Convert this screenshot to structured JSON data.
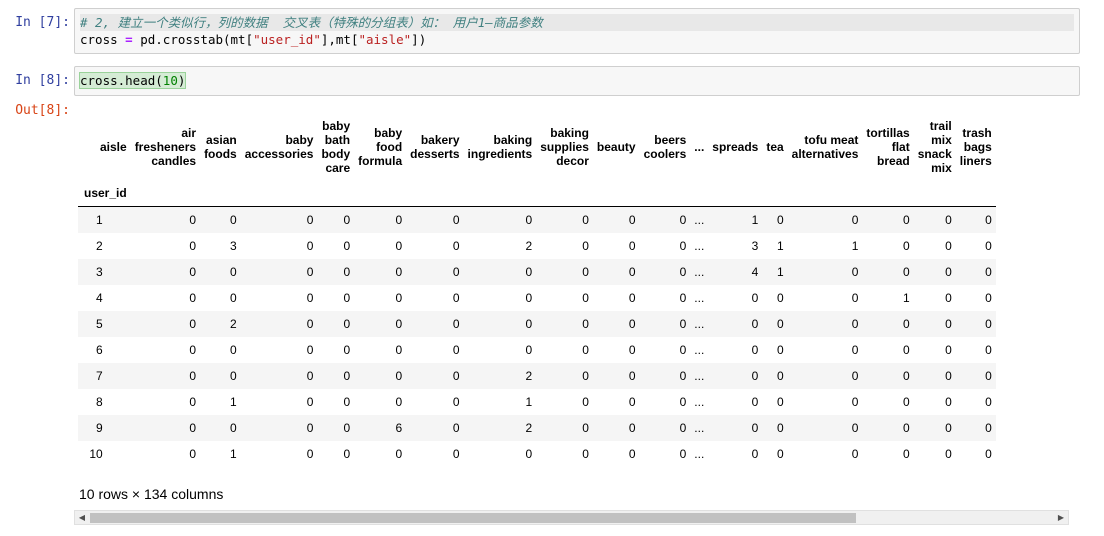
{
  "cells": [
    {
      "prompt": "In  [7]:",
      "comment": "# 2, 建立一个类似行，列的数据  交叉表（特殊的分组表）如： 用户1—商品参数",
      "code_pre": "cross ",
      "code_eq": "=",
      "code_mid": " pd.crosstab(mt[",
      "str1": "\"user_id\"",
      "code_mid2": "],mt[",
      "str2": "\"aisle\"",
      "code_end": "])"
    },
    {
      "prompt": "In  [8]:",
      "code_pre": "cross.head(",
      "num": "10",
      "code_end": ")"
    }
  ],
  "output": {
    "prompt": "Out[8]:",
    "column_label": "aisle",
    "index_label": "user_id",
    "columns": [
      [
        "air",
        "fresheners",
        "candles"
      ],
      [
        "asian",
        "foods"
      ],
      [
        "baby",
        "accessories"
      ],
      [
        "baby",
        "bath",
        "body",
        "care"
      ],
      [
        "baby",
        "food",
        "formula"
      ],
      [
        "bakery",
        "desserts"
      ],
      [
        "baking",
        "ingredients"
      ],
      [
        "baking",
        "supplies",
        "decor"
      ],
      [
        "beauty"
      ],
      [
        "beers",
        "coolers"
      ],
      [
        "..."
      ],
      [
        "spreads"
      ],
      [
        "tea"
      ],
      [
        "tofu meat",
        "alternatives"
      ],
      [
        "tortillas",
        "flat",
        "bread"
      ],
      [
        "trail",
        "mix",
        "snack",
        "mix"
      ],
      [
        "trash",
        "bags",
        "liners"
      ]
    ],
    "rows": [
      {
        "index": "1",
        "values": [
          "0",
          "0",
          "0",
          "0",
          "0",
          "0",
          "0",
          "0",
          "0",
          "0",
          "...",
          "1",
          "0",
          "0",
          "0",
          "0",
          "0"
        ]
      },
      {
        "index": "2",
        "values": [
          "0",
          "3",
          "0",
          "0",
          "0",
          "0",
          "2",
          "0",
          "0",
          "0",
          "...",
          "3",
          "1",
          "1",
          "0",
          "0",
          "0"
        ]
      },
      {
        "index": "3",
        "values": [
          "0",
          "0",
          "0",
          "0",
          "0",
          "0",
          "0",
          "0",
          "0",
          "0",
          "...",
          "4",
          "1",
          "0",
          "0",
          "0",
          "0"
        ]
      },
      {
        "index": "4",
        "values": [
          "0",
          "0",
          "0",
          "0",
          "0",
          "0",
          "0",
          "0",
          "0",
          "0",
          "...",
          "0",
          "0",
          "0",
          "1",
          "0",
          "0"
        ]
      },
      {
        "index": "5",
        "values": [
          "0",
          "2",
          "0",
          "0",
          "0",
          "0",
          "0",
          "0",
          "0",
          "0",
          "...",
          "0",
          "0",
          "0",
          "0",
          "0",
          "0"
        ]
      },
      {
        "index": "6",
        "values": [
          "0",
          "0",
          "0",
          "0",
          "0",
          "0",
          "0",
          "0",
          "0",
          "0",
          "...",
          "0",
          "0",
          "0",
          "0",
          "0",
          "0"
        ]
      },
      {
        "index": "7",
        "values": [
          "0",
          "0",
          "0",
          "0",
          "0",
          "0",
          "2",
          "0",
          "0",
          "0",
          "...",
          "0",
          "0",
          "0",
          "0",
          "0",
          "0"
        ]
      },
      {
        "index": "8",
        "values": [
          "0",
          "1",
          "0",
          "0",
          "0",
          "0",
          "1",
          "0",
          "0",
          "0",
          "...",
          "0",
          "0",
          "0",
          "0",
          "0",
          "0"
        ]
      },
      {
        "index": "9",
        "values": [
          "0",
          "0",
          "0",
          "0",
          "6",
          "0",
          "2",
          "0",
          "0",
          "0",
          "...",
          "0",
          "0",
          "0",
          "0",
          "0",
          "0"
        ]
      },
      {
        "index": "10",
        "values": [
          "0",
          "1",
          "0",
          "0",
          "0",
          "0",
          "0",
          "0",
          "0",
          "0",
          "...",
          "0",
          "0",
          "0",
          "0",
          "0",
          "0"
        ]
      }
    ],
    "shape_text": "10 rows × 134 columns"
  },
  "icons": {
    "scroll_left": "left-arrow-icon",
    "scroll_right": "right-arrow-icon"
  },
  "colors": {
    "prompt_in": "#303f9f",
    "prompt_out": "#d84315",
    "comment": "#408080",
    "string": "#ba2121",
    "number": "#008000"
  }
}
